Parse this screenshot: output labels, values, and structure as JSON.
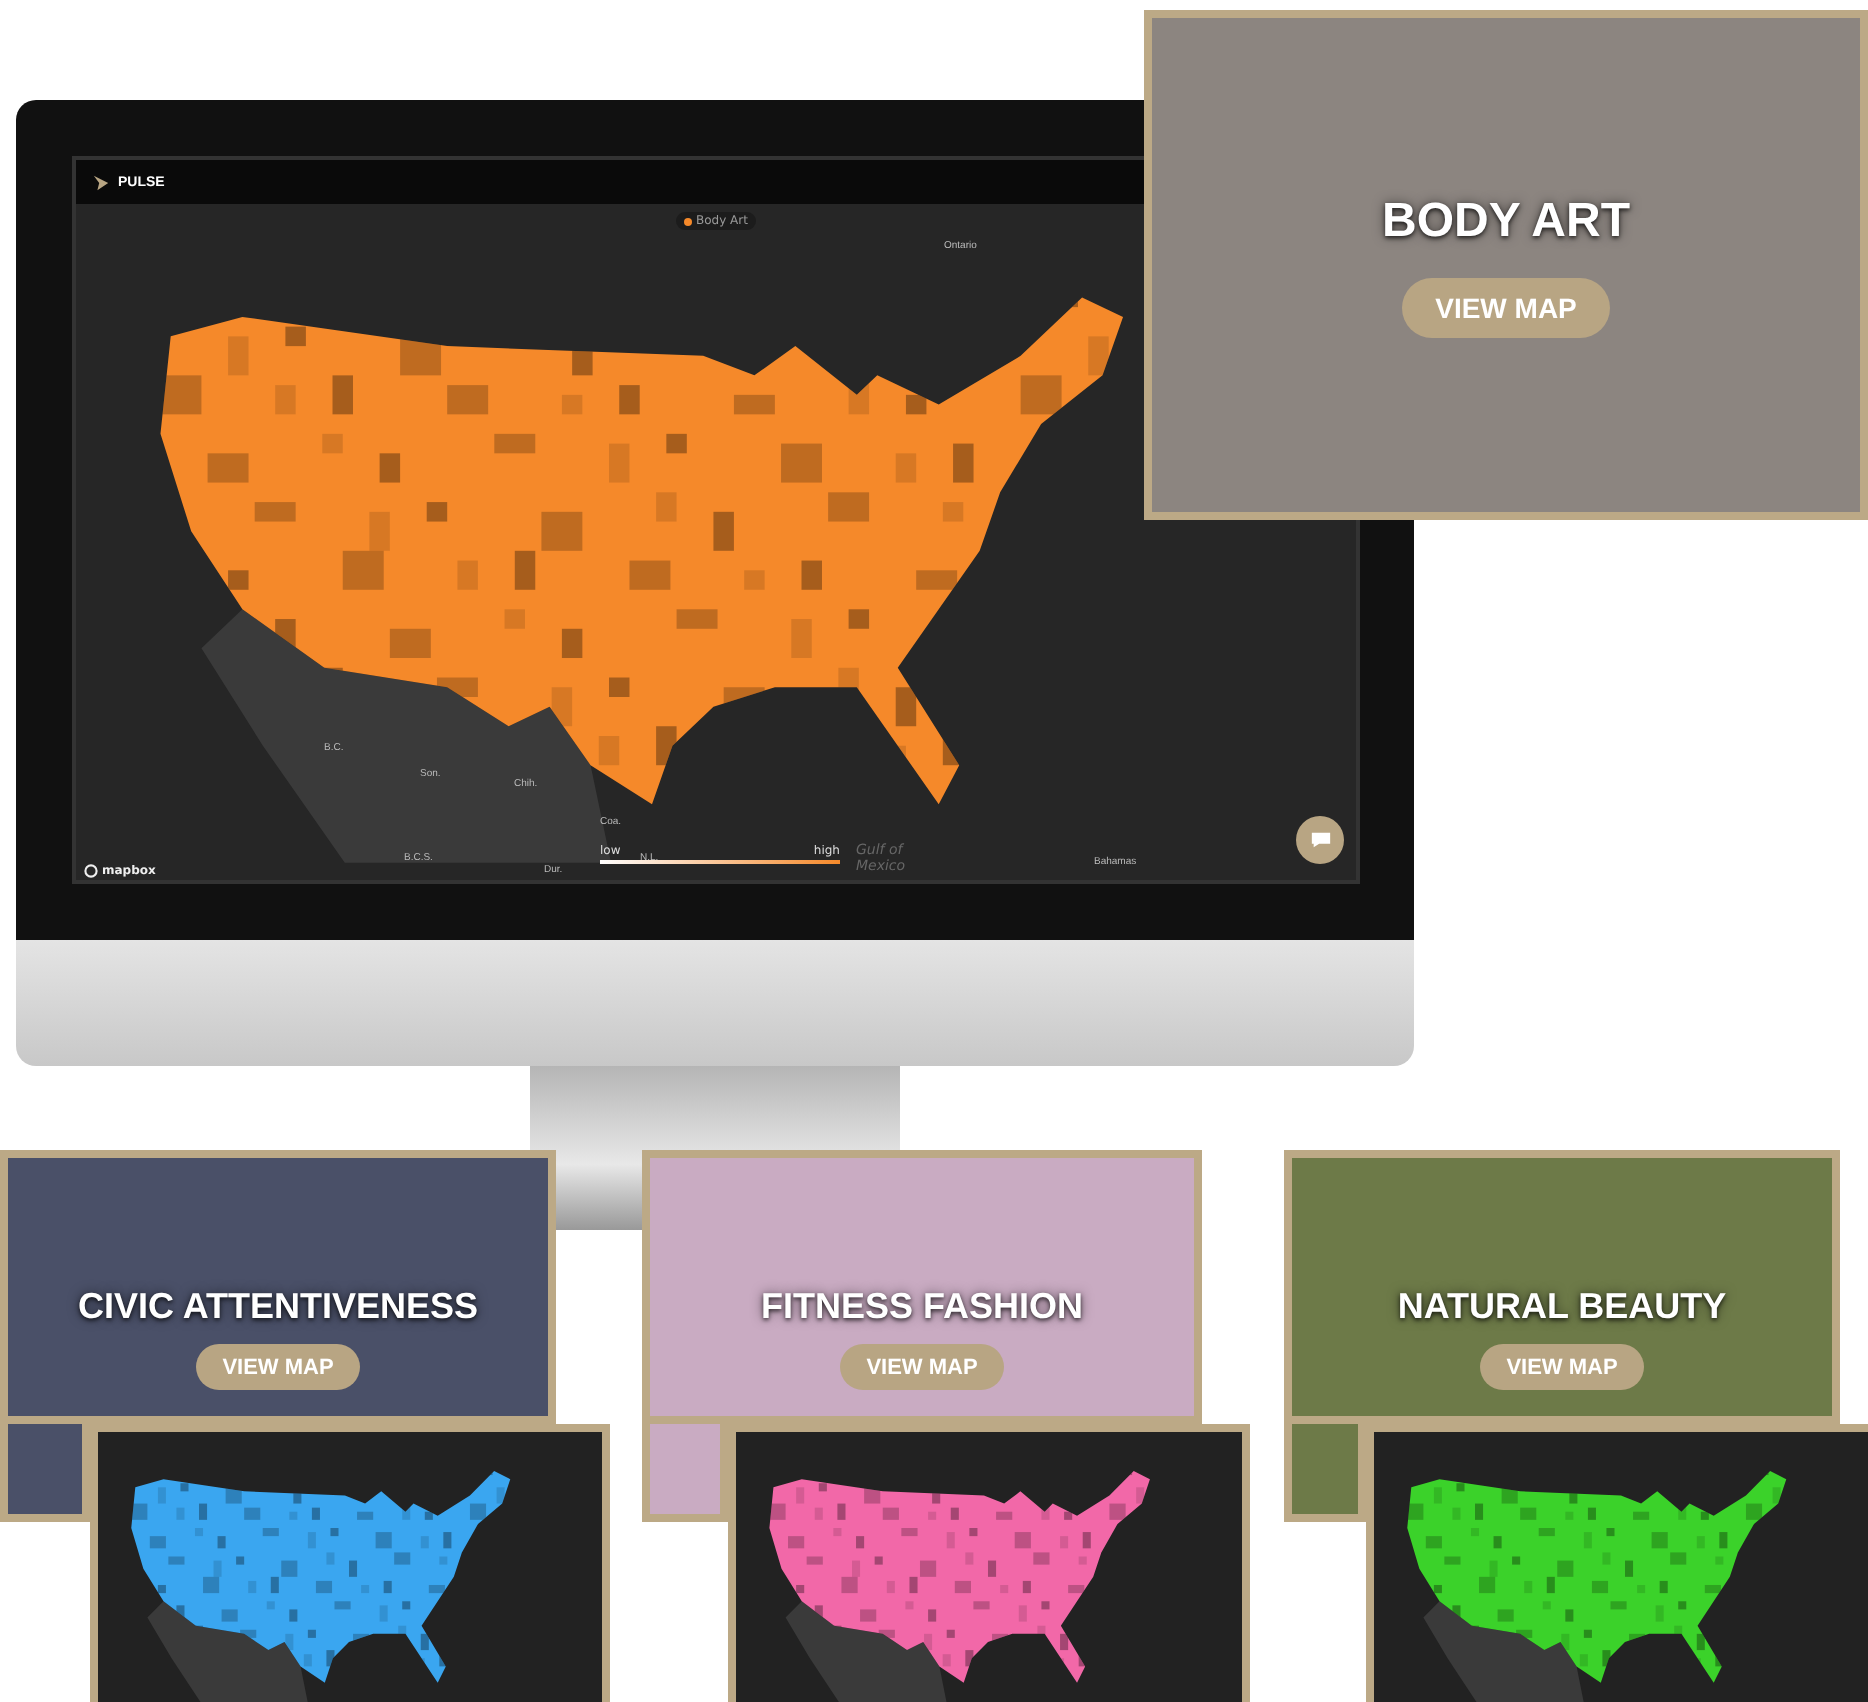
{
  "monitor_app": {
    "brand": "PULSE",
    "legend_chip": "Body Art",
    "map_labels": [
      "Ontario",
      "B.C.",
      "Son.",
      "Chih.",
      "Coa.",
      "B.C.S.",
      "Dur.",
      "N.L.",
      "Bahamas"
    ],
    "gulf_label": "Gulf of Mexico",
    "scale": {
      "low": "low",
      "high": "high"
    },
    "attribution": "mapbox"
  },
  "feature_card": {
    "title": "BODY ART",
    "button": "VIEW MAP"
  },
  "cards": [
    {
      "title": "CIVIC ATTENTIVENESS",
      "button": "VIEW MAP",
      "color": "#3aa6f0"
    },
    {
      "title": "FITNESS FASHION",
      "button": "VIEW MAP",
      "color": "#f268a8"
    },
    {
      "title": "NATURAL BEAUTY",
      "button": "VIEW MAP",
      "color": "#3bd22a"
    }
  ]
}
